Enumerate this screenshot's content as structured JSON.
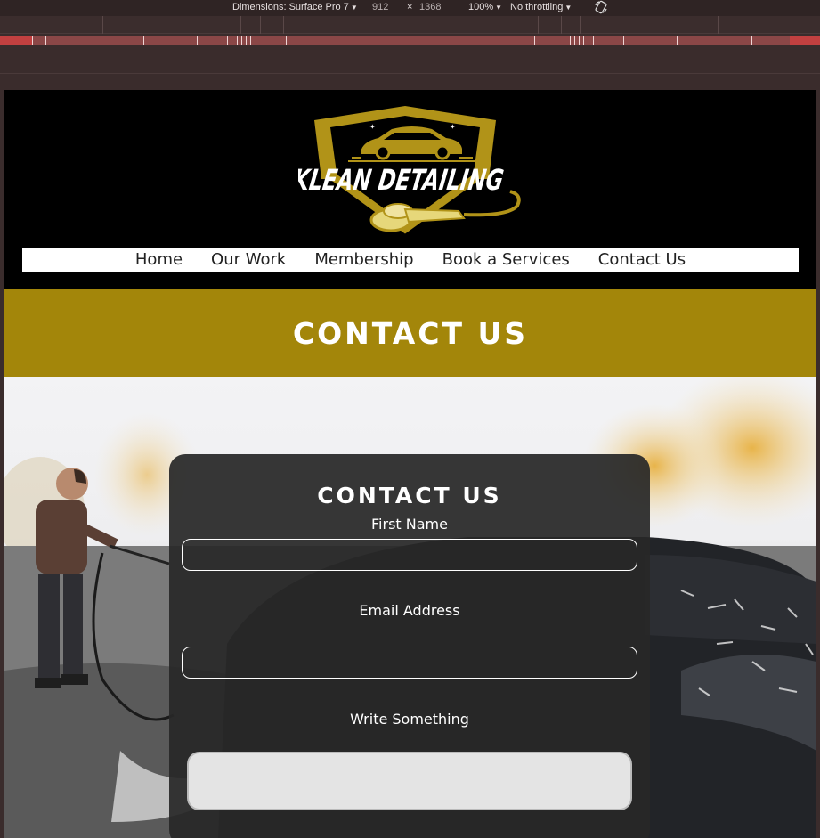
{
  "devtools": {
    "dimensions_label": "Dimensions: Surface Pro 7",
    "width": "912",
    "times": "×",
    "height": "1368",
    "zoom": "100%",
    "throttling": "No throttling",
    "rotate_icon": "rotate-icon"
  },
  "site": {
    "logo_text": "KLEAN DETAILING",
    "nav": [
      "Home",
      "Our Work",
      "Membership",
      "Book a Services",
      "Contact Us"
    ],
    "banner_title": "CONTACT US",
    "form": {
      "title": "CONTACT US",
      "first_name_label": "First Name",
      "email_label": "Email Address",
      "message_label": "Write Something",
      "first_name_value": "",
      "email_value": "",
      "message_value": ""
    }
  },
  "colors": {
    "brand_gold": "#a3860a",
    "logo_gold": "#c9a80e",
    "header_bg": "#000000",
    "devtools_bg": "#2f2424"
  }
}
